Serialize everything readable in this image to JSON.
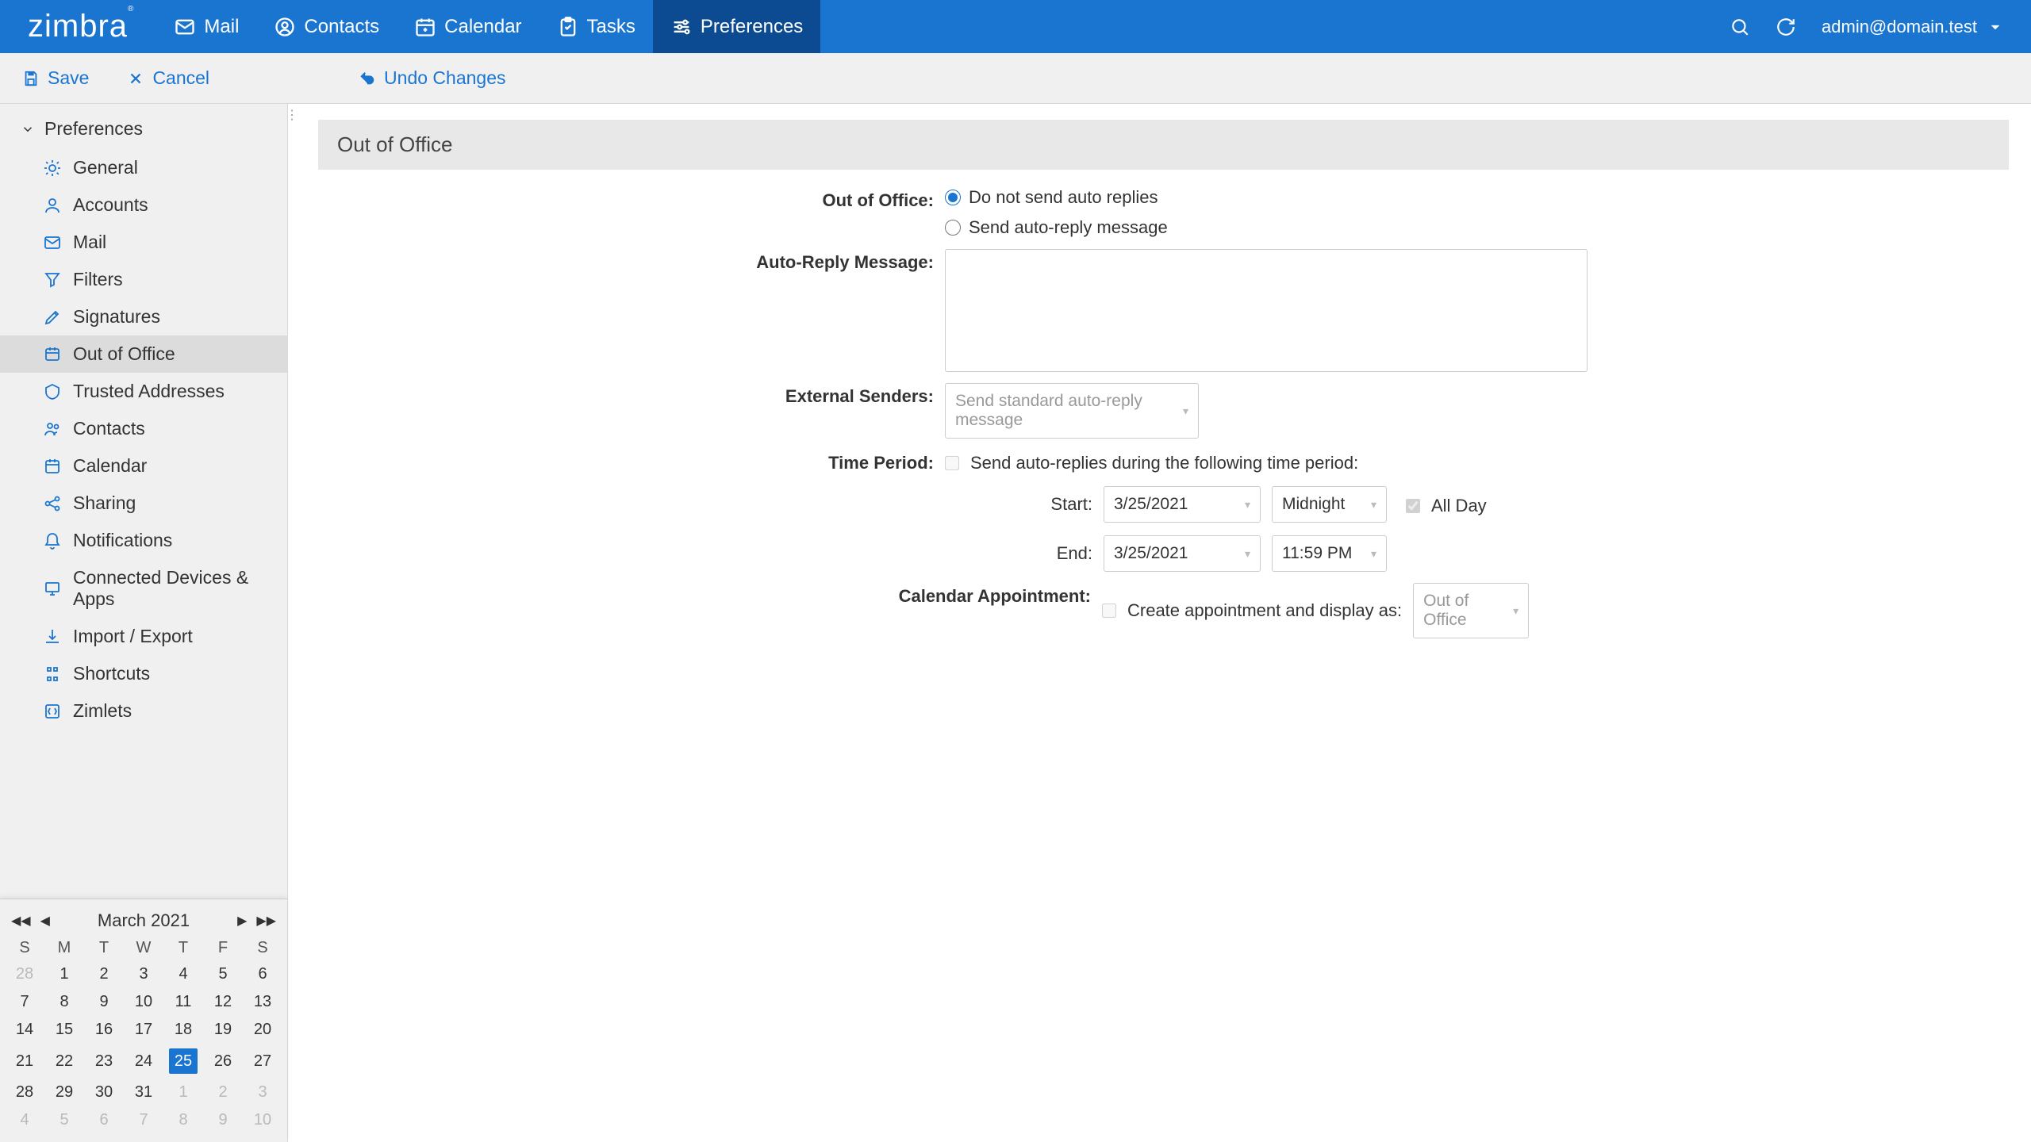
{
  "topnav": {
    "logo": "zimbra",
    "tabs": [
      {
        "label": "Mail"
      },
      {
        "label": "Contacts"
      },
      {
        "label": "Calendar"
      },
      {
        "label": "Tasks"
      },
      {
        "label": "Preferences",
        "active": true
      }
    ],
    "account": "admin@domain.test"
  },
  "toolbar": {
    "save": "Save",
    "cancel": "Cancel",
    "undo": "Undo Changes"
  },
  "sidebar": {
    "header": "Preferences",
    "items": [
      {
        "label": "General"
      },
      {
        "label": "Accounts"
      },
      {
        "label": "Mail"
      },
      {
        "label": "Filters"
      },
      {
        "label": "Signatures"
      },
      {
        "label": "Out of Office",
        "selected": true
      },
      {
        "label": "Trusted Addresses"
      },
      {
        "label": "Contacts"
      },
      {
        "label": "Calendar"
      },
      {
        "label": "Sharing"
      },
      {
        "label": "Notifications"
      },
      {
        "label": "Connected Devices & Apps"
      },
      {
        "label": "Import / Export"
      },
      {
        "label": "Shortcuts"
      },
      {
        "label": "Zimlets"
      }
    ]
  },
  "panel": {
    "title": "Out of Office",
    "labels": {
      "ooo": "Out of Office:",
      "opt1": "Do not send auto replies",
      "opt2": "Send auto-reply message",
      "msg": "Auto-Reply Message:",
      "ext": "External Senders:",
      "ext_val": "Send standard auto-reply message",
      "tp": "Time Period:",
      "tp_chk": "Send auto-replies during the following time period:",
      "start": "Start:",
      "end": "End:",
      "start_date": "3/25/2021",
      "start_time": "Midnight",
      "end_date": "3/25/2021",
      "end_time": "11:59 PM",
      "allday": "All Day",
      "calappt": "Calendar Appointment:",
      "calappt_chk": "Create appointment and display as:",
      "calappt_val": "Out of Office"
    }
  },
  "calendar": {
    "title": "March 2021",
    "dow": [
      "S",
      "M",
      "T",
      "W",
      "T",
      "F",
      "S"
    ],
    "weeks": [
      [
        {
          "d": "28",
          "dim": true
        },
        {
          "d": "1"
        },
        {
          "d": "2"
        },
        {
          "d": "3"
        },
        {
          "d": "4"
        },
        {
          "d": "5"
        },
        {
          "d": "6"
        }
      ],
      [
        {
          "d": "7"
        },
        {
          "d": "8"
        },
        {
          "d": "9"
        },
        {
          "d": "10"
        },
        {
          "d": "11"
        },
        {
          "d": "12"
        },
        {
          "d": "13"
        }
      ],
      [
        {
          "d": "14"
        },
        {
          "d": "15"
        },
        {
          "d": "16"
        },
        {
          "d": "17"
        },
        {
          "d": "18"
        },
        {
          "d": "19"
        },
        {
          "d": "20"
        }
      ],
      [
        {
          "d": "21"
        },
        {
          "d": "22"
        },
        {
          "d": "23"
        },
        {
          "d": "24"
        },
        {
          "d": "25",
          "today": true
        },
        {
          "d": "26"
        },
        {
          "d": "27"
        }
      ],
      [
        {
          "d": "28"
        },
        {
          "d": "29"
        },
        {
          "d": "30"
        },
        {
          "d": "31"
        },
        {
          "d": "1",
          "dim": true
        },
        {
          "d": "2",
          "dim": true
        },
        {
          "d": "3",
          "dim": true
        }
      ],
      [
        {
          "d": "4",
          "dim": true
        },
        {
          "d": "5",
          "dim": true
        },
        {
          "d": "6",
          "dim": true
        },
        {
          "d": "7",
          "dim": true
        },
        {
          "d": "8",
          "dim": true
        },
        {
          "d": "9",
          "dim": true
        },
        {
          "d": "10",
          "dim": true
        }
      ]
    ]
  }
}
